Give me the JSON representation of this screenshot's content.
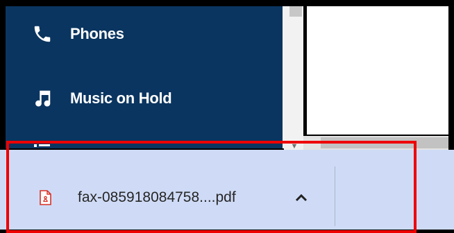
{
  "sidebar": {
    "items": [
      {
        "label": "Phones",
        "icon": "phone-icon"
      },
      {
        "label": "Music on Hold",
        "icon": "music-note-icon"
      },
      {
        "label": "",
        "icon": "list-icon"
      }
    ]
  },
  "download_shelf": {
    "file_name": "fax-085918084758....pdf",
    "file_icon": "pdf-icon",
    "menu_icon": "chevron-up-icon"
  },
  "colors": {
    "sidebar_bg": "#0a3560",
    "shelf_bg": "#cfdbf6",
    "highlight": "#ee0000",
    "pdf_red": "#d93025"
  }
}
